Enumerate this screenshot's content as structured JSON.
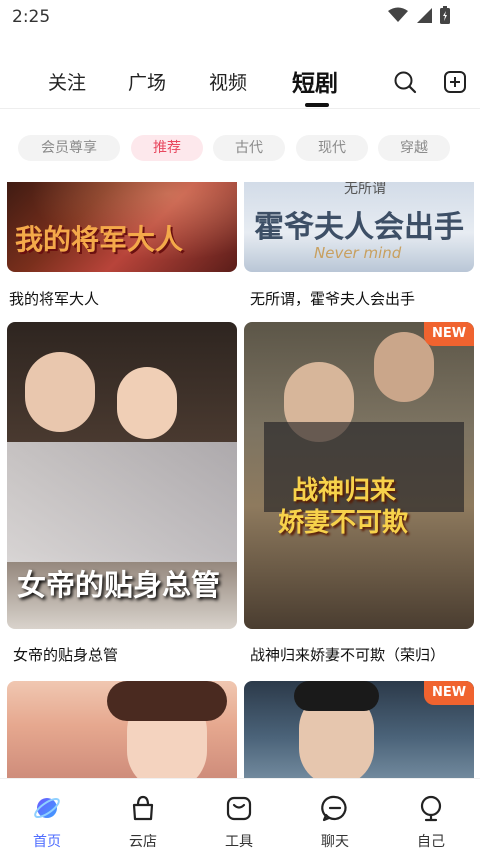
{
  "status_bar": {
    "time": "2:25"
  },
  "top_tabs": {
    "items": [
      "关注",
      "广场",
      "视频",
      "短剧"
    ],
    "active": "短剧"
  },
  "chips": [
    "会员尊享",
    "推荐",
    "古代",
    "现代",
    "穿越"
  ],
  "chip_active": "推荐",
  "cards": [
    {
      "title": "我的将军大人",
      "poster_text": "我的将军大人"
    },
    {
      "title": "无所谓，霍爷夫人会出手",
      "poster_text": "霍爷夫人会出手",
      "poster_subtext": "无所谓",
      "poster_en": "Never mind"
    },
    {
      "title": "女帝的贴身总管",
      "poster_text": "女帝的贴身总管"
    },
    {
      "title": "战神归来娇妻不可欺（荣归）",
      "poster_text_line1": "战神归来",
      "poster_text_line2": "娇妻不可欺",
      "badge": "NEW"
    },
    {
      "title": "",
      "badge": ""
    },
    {
      "title": "",
      "badge": "NEW"
    }
  ],
  "bottom_nav": [
    "首页",
    "云店",
    "工具",
    "聊天",
    "自己"
  ],
  "bottom_nav_active": "首页",
  "colors": {
    "accent_red": "#e8485f",
    "accent_blue": "#4f6dff",
    "badge_orange": "#f0632f"
  }
}
